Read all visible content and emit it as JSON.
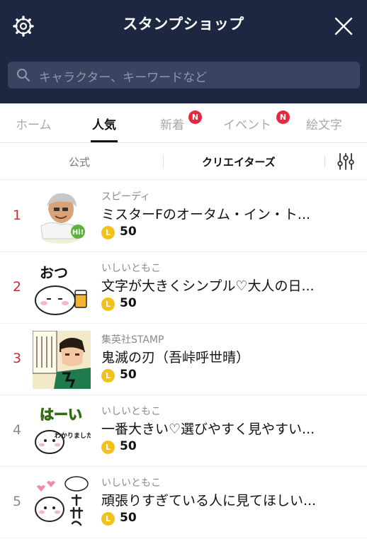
{
  "header": {
    "title": "スタンプショップ",
    "search_placeholder": "キャラクター、キーワードなど"
  },
  "tabs": [
    {
      "label": "ホーム",
      "active": false
    },
    {
      "label": "人気",
      "active": true
    },
    {
      "label": "新着",
      "active": false,
      "badge": "N"
    },
    {
      "label": "イベント",
      "active": false,
      "badge": "N"
    },
    {
      "label": "絵文字",
      "active": false
    }
  ],
  "subtabs": [
    {
      "label": "公式",
      "active": false
    },
    {
      "label": "クリエイターズ",
      "active": true
    }
  ],
  "items": [
    {
      "rank": "1",
      "creator": "スピーディ",
      "title": "ミスターFのオータム・イン・ト...",
      "price": "50",
      "sticker_text": "Hi!"
    },
    {
      "rank": "2",
      "creator": "いしいともこ",
      "title": "文字が大きくシンプル♡大人の日...",
      "price": "50",
      "sticker_text": "おつ"
    },
    {
      "rank": "3",
      "creator": "集英社STAMP",
      "title": "鬼滅の刃（吾峠呼世晴）",
      "price": "50"
    },
    {
      "rank": "4",
      "creator": "いしいともこ",
      "title": "一番大きい♡選びやすく見やすい...",
      "price": "50",
      "sticker_text": "はーい",
      "sticker_sub": "わかりました!!"
    },
    {
      "rank": "5",
      "creator": "いしいともこ",
      "title": "頑張りすぎている人に見てほしい...",
      "price": "50"
    }
  ],
  "coin_letter": "L",
  "colors": {
    "header_bg": "#1d2742",
    "rank_top": "#c0303a",
    "badge": "#e8283e",
    "coin": "#f2c21b"
  },
  "icons": [
    "gear-icon",
    "close-icon",
    "search-icon",
    "filter-icon",
    "coin-icon"
  ]
}
